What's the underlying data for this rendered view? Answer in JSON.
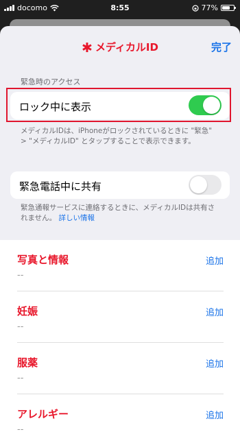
{
  "status_bar": {
    "carrier": "docomo",
    "time": "8:55",
    "battery_text": "77%",
    "battery_level": 0.77,
    "icons": [
      "signal-icon",
      "wifi-icon",
      "lock-rotation-icon",
      "battery-icon"
    ]
  },
  "nav": {
    "title": "メディカルID",
    "star_icon": "✱",
    "done_label": "完了"
  },
  "emergency_access": {
    "section_label": "緊急時のアクセス",
    "show_when_locked": {
      "label": "ロック中に表示",
      "on": true
    },
    "show_when_locked_note": "メディカルIDは、iPhoneがロックされているときに \"緊急\" > \"メディカルID\" とタップすることで表示できます。",
    "share_during_call": {
      "label": "緊急電話中に共有",
      "on": false
    },
    "share_note": "緊急通報サービスに連絡するときに、メディカルIDは共有されません。",
    "more_info_link": "詳しい情報"
  },
  "medical_fields": [
    {
      "title": "写真と情報",
      "value": "--",
      "action": "追加"
    },
    {
      "title": "妊娠",
      "value": "--",
      "action": "追加"
    },
    {
      "title": "服薬",
      "value": "--",
      "action": "追加"
    },
    {
      "title": "アレルギー",
      "value": "--",
      "action": "追加"
    }
  ],
  "colors": {
    "accent_red": "#e8172b",
    "link_blue": "#1a73e8",
    "toggle_on": "#2fcb4f",
    "highlight_border": "#e0152e"
  }
}
